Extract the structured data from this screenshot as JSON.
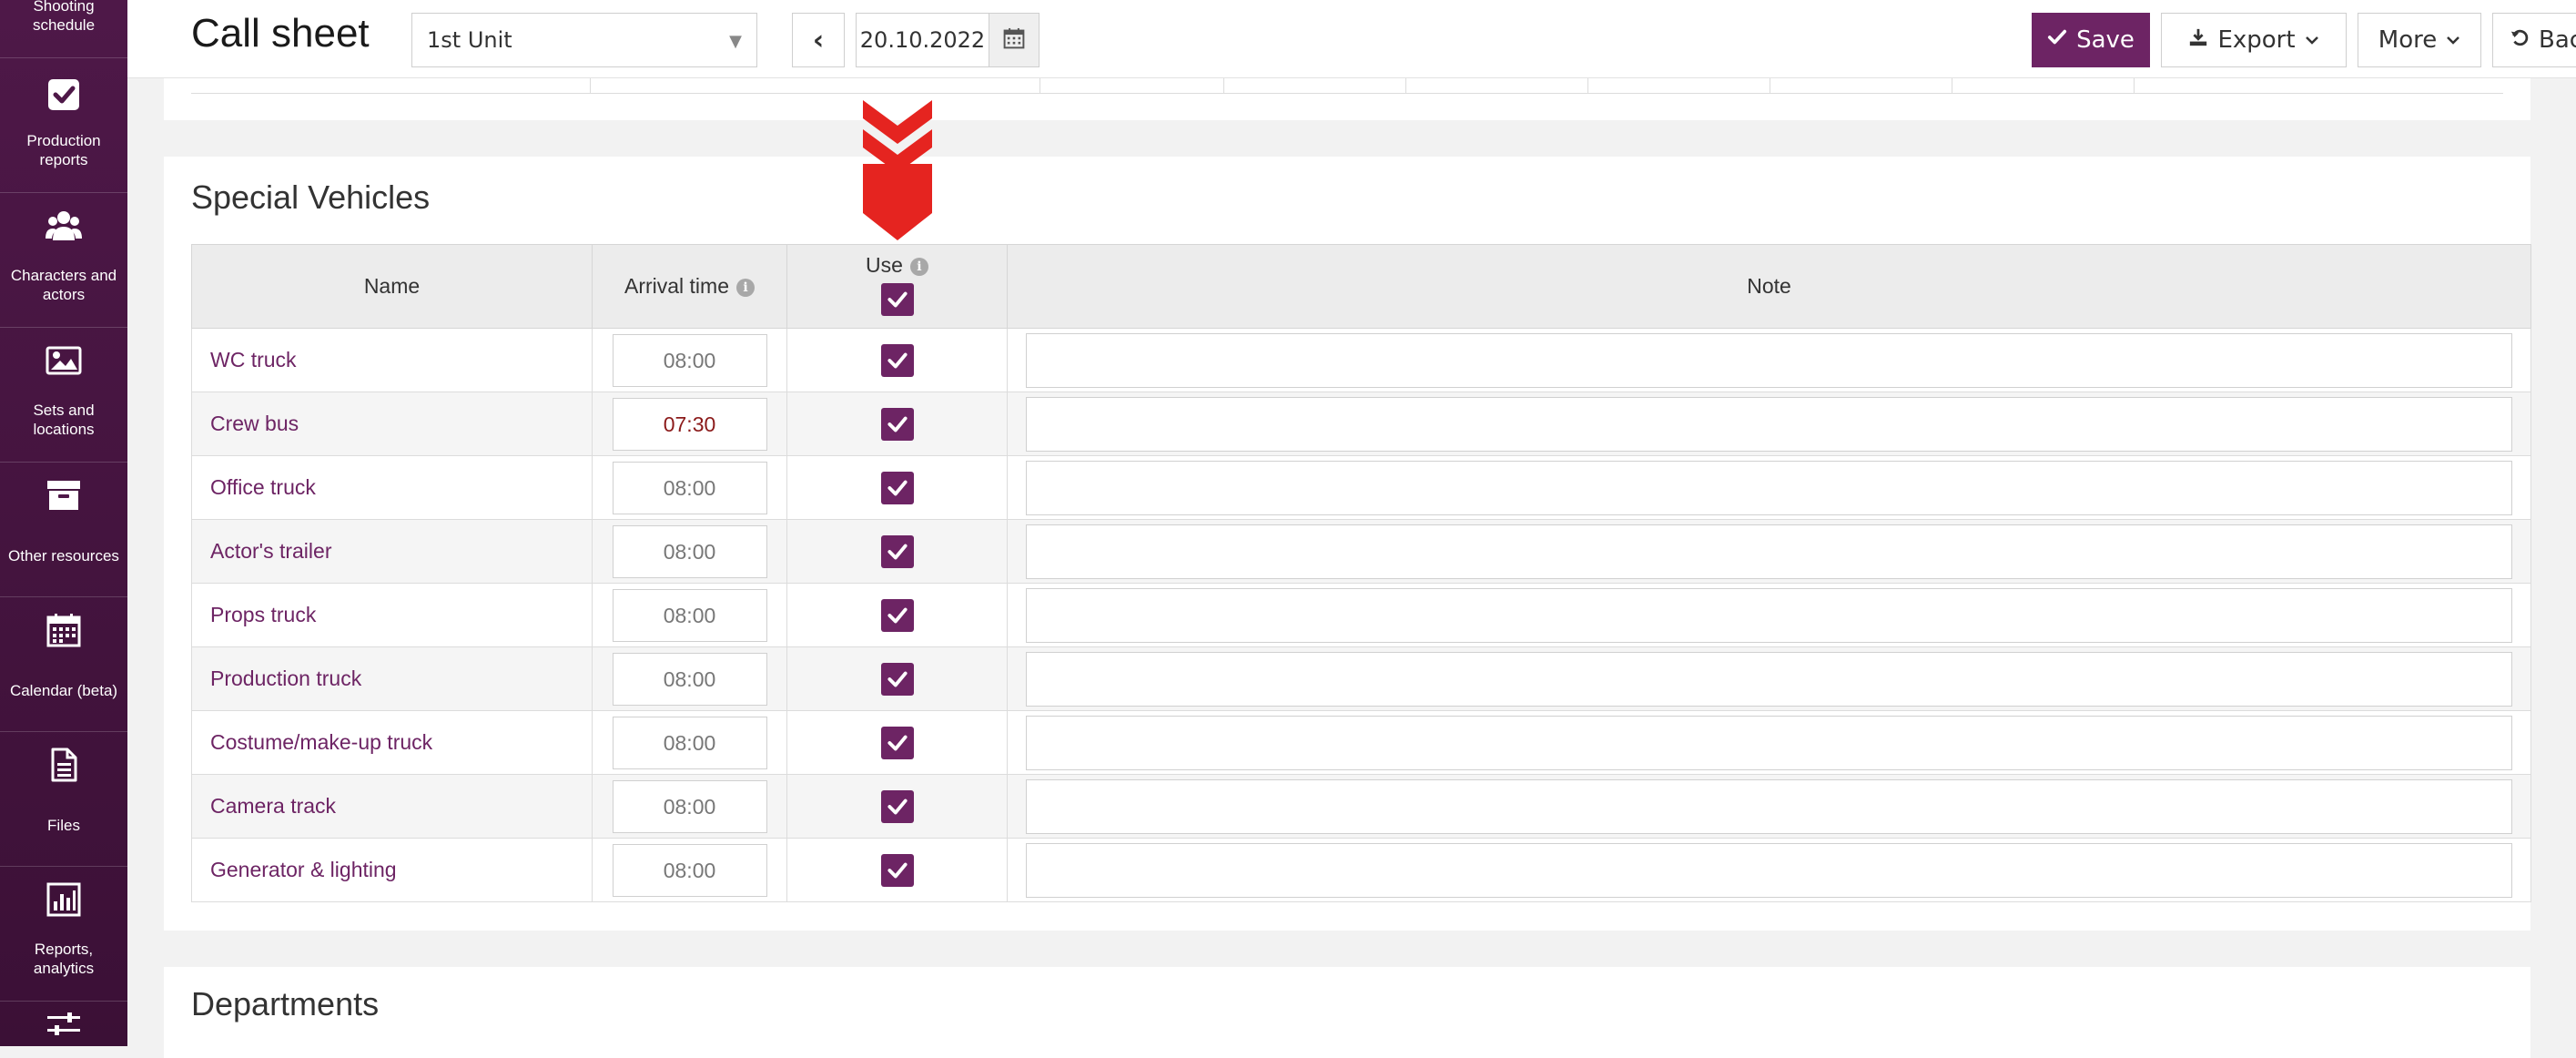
{
  "sidebar": {
    "items": [
      {
        "label": "Shooting schedule",
        "icon": "clapper-icon"
      },
      {
        "label": "Production reports",
        "icon": "checkbox-icon"
      },
      {
        "label": "Characters and actors",
        "icon": "users-icon"
      },
      {
        "label": "Sets and locations",
        "icon": "image-icon"
      },
      {
        "label": "Other resources",
        "icon": "archive-icon"
      },
      {
        "label": "Calendar (beta)",
        "icon": "calendar-icon"
      },
      {
        "label": "Files",
        "icon": "file-icon"
      },
      {
        "label": "Reports, analytics",
        "icon": "bar-chart-icon"
      },
      {
        "label": "",
        "icon": "sliders-icon"
      }
    ]
  },
  "header": {
    "title": "Call sheet",
    "unit_select": "1st Unit",
    "prev_label": "‹",
    "date": "20.10.2022",
    "save_label": "Save",
    "export_label": "Export",
    "more_label": "More",
    "back_label": "Back"
  },
  "vehicles": {
    "title": "Special Vehicles",
    "columns": {
      "name": "Name",
      "arrival": "Arrival time",
      "use": "Use",
      "note": "Note"
    },
    "rows": [
      {
        "name": "WC truck",
        "time": "08:00",
        "use": true,
        "note": ""
      },
      {
        "name": "Crew bus",
        "time": "07:30",
        "use": true,
        "note": ""
      },
      {
        "name": "Office truck",
        "time": "08:00",
        "use": true,
        "note": ""
      },
      {
        "name": "Actor's trailer",
        "time": "08:00",
        "use": true,
        "note": ""
      },
      {
        "name": "Props truck",
        "time": "08:00",
        "use": true,
        "note": ""
      },
      {
        "name": "Production truck",
        "time": "08:00",
        "use": true,
        "note": ""
      },
      {
        "name": "Costume/make-up truck",
        "time": "08:00",
        "use": true,
        "note": ""
      },
      {
        "name": "Camera track",
        "time": "08:00",
        "use": true,
        "note": ""
      },
      {
        "name": "Generator & lighting",
        "time": "08:00",
        "use": true,
        "note": ""
      }
    ]
  },
  "departments": {
    "title": "Departments"
  },
  "colors": {
    "brand": "#6d2464",
    "sidebar": "#4e1848",
    "annotation": "#e52420"
  }
}
